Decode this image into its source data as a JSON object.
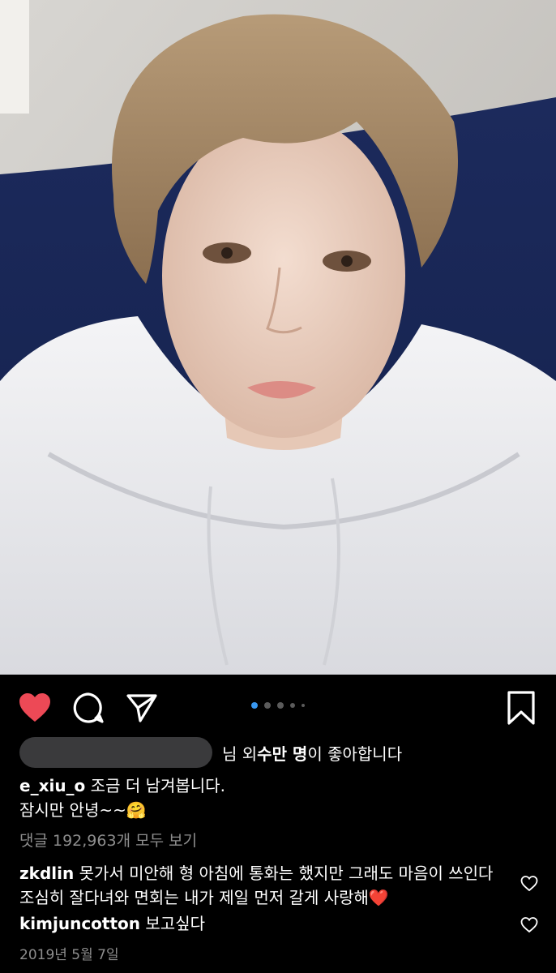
{
  "post": {
    "likes_suffix_1": "님 외 ",
    "likes_bold": "수만 명",
    "likes_suffix_2": "이 좋아합니다",
    "caption_user": "e_xiu_o",
    "caption_line1": "조금 더 남겨봅니다.",
    "caption_line2": "잠시만 안녕~~🤗",
    "view_all": "댓글 192,963개 모두 보기",
    "date": "2019년 5월 7일"
  },
  "comments": [
    {
      "user": "zkdlin",
      "text": "못가서 미안해 형 아침에 통화는 했지만 그래도 마음이 쓰인다 조심히 잘다녀와 면회는 내가 제일 먼저 갈게 사랑해❤️"
    },
    {
      "user": "kimjuncotton",
      "text": "보고싶다"
    }
  ],
  "carousel": {
    "count": 5,
    "active": 0
  },
  "icons": {
    "like": "heart-filled-icon",
    "comment": "comment-bubble-icon",
    "share": "send-paper-plane-icon",
    "save": "bookmark-icon",
    "comment_like": "heart-outline-icon"
  },
  "colors": {
    "like_red": "#ed4956",
    "dot_active": "#3897f0",
    "muted": "#8e8e8e"
  }
}
